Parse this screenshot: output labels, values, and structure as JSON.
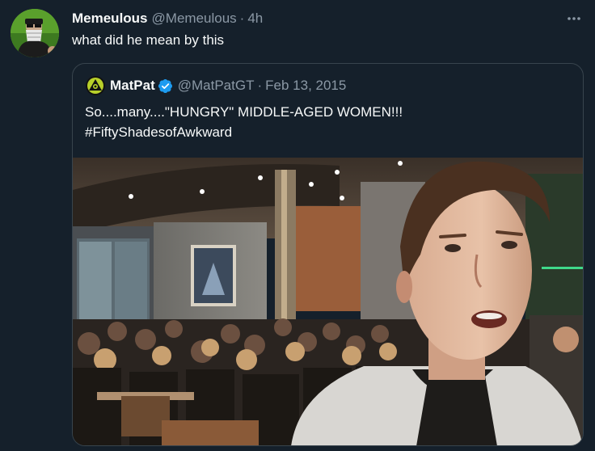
{
  "tweet": {
    "display_name": "Memeulous",
    "handle": "@Memeulous",
    "separator": "·",
    "time": "4h",
    "text": "what did he mean by this",
    "more_label": "•••"
  },
  "quote": {
    "display_name": "MatPat",
    "handle": "@MatPatGT",
    "separator": "·",
    "date": "Feb 13, 2015",
    "text_line1": "So....many....\"HUNGRY\" MIDDLE-AGED WOMEN!!!",
    "text_line2": "#FiftyShadesofAwkward"
  },
  "colors": {
    "background": "#15202b",
    "text_primary": "#f7f9f9",
    "text_secondary": "#8b98a5",
    "border": "#38444d",
    "verified": "#1d9bf0"
  },
  "icons": {
    "more": "more-horizontal-icon",
    "verified": "verified-badge-icon"
  }
}
